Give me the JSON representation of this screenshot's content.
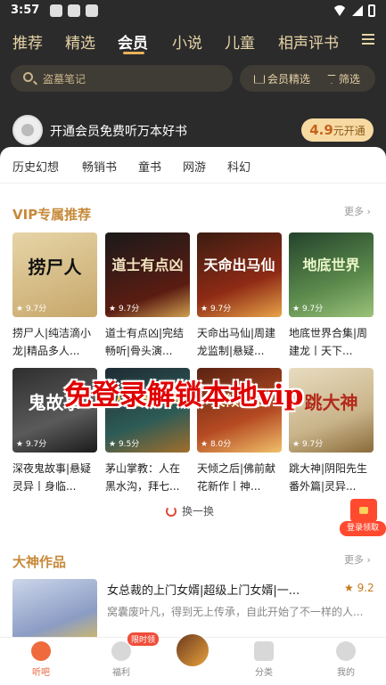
{
  "status_bar": {
    "time": "3:57"
  },
  "top_tabs": [
    {
      "label": "推荐"
    },
    {
      "label": "精选"
    },
    {
      "label": "会员"
    },
    {
      "label": "小说"
    },
    {
      "label": "儿童"
    },
    {
      "label": "相声评书"
    }
  ],
  "active_tab": "会员",
  "search": {
    "placeholder": "盗墓笔记"
  },
  "filters": {
    "vip_select": "会员精选",
    "filter": "筛选"
  },
  "vip_promo": {
    "text": "开通会员免费听万本好书",
    "price": "4.9",
    "unit": "元",
    "action": "开通"
  },
  "categories": [
    {
      "label": "历史幻想"
    },
    {
      "label": "畅销书"
    },
    {
      "label": "童书"
    },
    {
      "label": "网游"
    },
    {
      "label": "科幻"
    }
  ],
  "vip_section": {
    "title": "VIP专属推荐",
    "more": "更多 ›"
  },
  "vip_books": [
    {
      "cover_text": "捞尸人",
      "rating": "9.7分",
      "title": "捞尸人|纯洁滴小龙|精品多人..."
    },
    {
      "cover_text": "道士有点凶",
      "rating": "9.7分",
      "title": "道士有点凶|完结畅听|骨头演..."
    },
    {
      "cover_text": "天命出马仙",
      "rating": "9.7分",
      "title": "天命出马仙|周建龙监制|悬疑..."
    },
    {
      "cover_text": "地底世界",
      "rating": "9.7分",
      "title": "地底世界合集|周建龙丨天下..."
    },
    {
      "cover_text": "鬼故事",
      "rating": "9.7分",
      "title": "深夜鬼故事|悬疑灵异丨身临..."
    },
    {
      "cover_text": "人在黑水沟",
      "rating": "9.5分",
      "title": "茅山掌教：人在黑水沟，拜七..."
    },
    {
      "cover_text": "天倾之后",
      "rating": "8.0分",
      "title": "天倾之后|佛前献花新作丨神..."
    },
    {
      "cover_text": "跳大神",
      "rating": "9.7分",
      "title": "跳大神|阴阳先生番外篇|灵异..."
    }
  ],
  "refresh": "换一换",
  "watermark": "免登录解锁本地vip",
  "float_redpacket": {
    "label": "登录领取"
  },
  "god_section": {
    "title": "大神作品",
    "more": "更多 ›"
  },
  "god_book": {
    "title": "女总裁的上门女婿|超级上门女婿|一...",
    "rating": "★ 9.2",
    "desc": "窝囊废叶凡，得到无上传承，自此开始了不一样的人..."
  },
  "bottom_nav": [
    {
      "label": "听吧"
    },
    {
      "label": "福利"
    },
    {
      "label": ""
    },
    {
      "label": "分类"
    },
    {
      "label": "我的"
    }
  ],
  "bottom_badge": "限时领",
  "colors": {
    "header_bg": "#2b2b2b",
    "accent_gold": "#c78a3a",
    "active_nav": "#e8643c",
    "watermark_red": "#e10000"
  }
}
